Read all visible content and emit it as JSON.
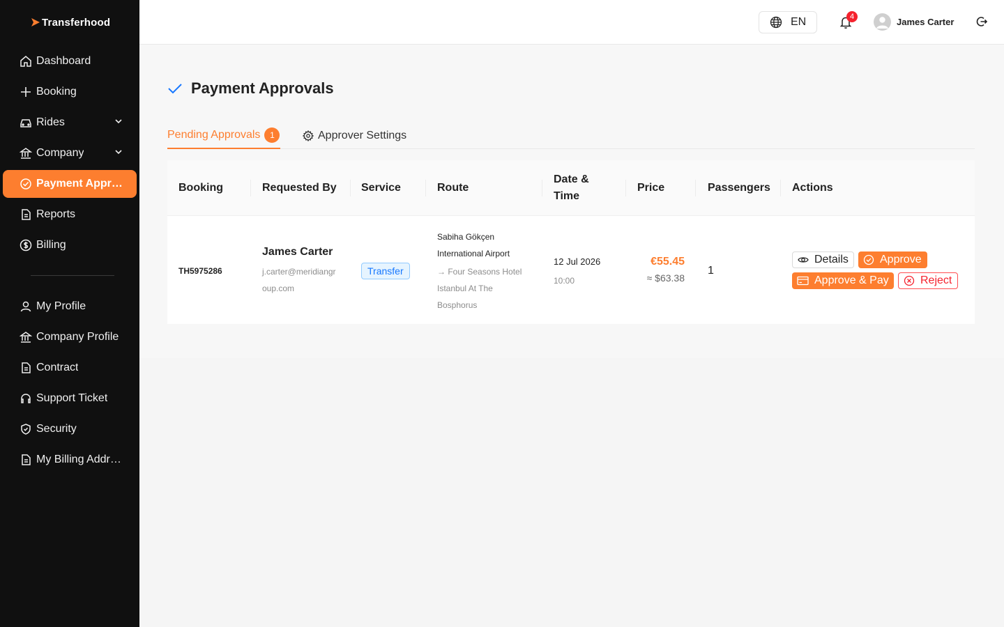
{
  "brand": {
    "name": "Transferhood"
  },
  "sidebar": {
    "items": [
      {
        "label": "Dashboard",
        "icon": "home-icon"
      },
      {
        "label": "Booking",
        "icon": "plus-icon"
      },
      {
        "label": "Rides",
        "icon": "car-icon",
        "expandable": true
      },
      {
        "label": "Company",
        "icon": "bank-icon",
        "expandable": true
      },
      {
        "label": "Payment Approvals",
        "icon": "check-circle-icon",
        "active": true
      },
      {
        "label": "Reports",
        "icon": "file-icon"
      },
      {
        "label": "Billing",
        "icon": "dollar-icon"
      },
      {
        "label": "My Profile",
        "icon": "user-icon"
      },
      {
        "label": "Company Profile",
        "icon": "bank-icon"
      },
      {
        "label": "Contract",
        "icon": "file-icon"
      },
      {
        "label": "Support Ticket",
        "icon": "headset-icon"
      },
      {
        "label": "Security",
        "icon": "shield-icon"
      },
      {
        "label": "My Billing Address",
        "icon": "file-icon"
      }
    ]
  },
  "header": {
    "language": "EN",
    "notification_count": "4",
    "user_name": "James Carter"
  },
  "page": {
    "title": "Payment Approvals",
    "tabs": [
      {
        "label": "Pending Approvals",
        "badge": "1",
        "active": true
      },
      {
        "label": "Approver Settings",
        "icon": "gear-icon"
      }
    ]
  },
  "table": {
    "columns": [
      "Booking",
      "Requested By",
      "Service",
      "Route",
      "Date & Time",
      "Price",
      "Passengers",
      "Actions"
    ],
    "rows": [
      {
        "booking": "TH5975286",
        "requested_by_name": "James Carter",
        "requested_by_email": "j.carter@meridiangroup.com",
        "service": "Transfer",
        "route_from": "Sabiha Gökçen International Airport",
        "route_to": "→ Four Seasons Hotel Istanbul At The Bosphorus",
        "date": "12 Jul 2026",
        "time": "10:00",
        "price_eur": "€55.45",
        "price_usd": "≈ $63.38",
        "passengers": "1",
        "actions": {
          "details": "Details",
          "approve": "Approve",
          "approve_pay": "Approve & Pay",
          "reject": "Reject"
        }
      }
    ]
  },
  "colors": {
    "accent": "#fd7e2f",
    "sidebar_bg": "#101010",
    "link_blue": "#1677ff",
    "danger": "#f5222d"
  }
}
